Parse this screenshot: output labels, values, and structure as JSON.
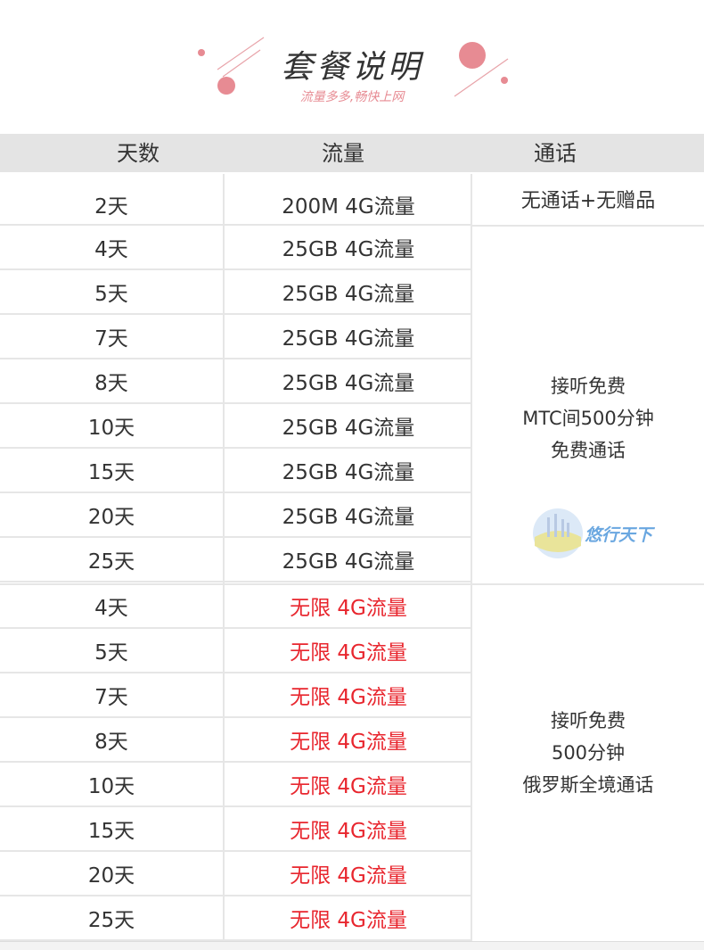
{
  "header": {
    "title": "套餐说明",
    "subtitle": "流量多多,畅快上网"
  },
  "table": {
    "headers": [
      "天数",
      "流量",
      "通话"
    ],
    "rows": [
      {
        "days": "2天",
        "data": "200M 4G流量",
        "red": false
      },
      {
        "days": "4天",
        "data": "25GB 4G流量",
        "red": false
      },
      {
        "days": "5天",
        "data": "25GB 4G流量",
        "red": false
      },
      {
        "days": "7天",
        "data": "25GB 4G流量",
        "red": false
      },
      {
        "days": "8天",
        "data": "25GB 4G流量",
        "red": false
      },
      {
        "days": "10天",
        "data": "25GB 4G流量",
        "red": false
      },
      {
        "days": "15天",
        "data": "25GB 4G流量",
        "red": false
      },
      {
        "days": "20天",
        "data": "25GB 4G流量",
        "red": false
      },
      {
        "days": "25天",
        "data": "25GB 4G流量",
        "red": false
      },
      {
        "days": "4天",
        "data": "无限 4G流量",
        "red": true
      },
      {
        "days": "5天",
        "data": "无限 4G流量",
        "red": true
      },
      {
        "days": "7天",
        "data": "无限 4G流量",
        "red": true
      },
      {
        "days": "8天",
        "data": "无限 4G流量",
        "red": true
      },
      {
        "days": "10天",
        "data": "无限 4G流量",
        "red": true
      },
      {
        "days": "15天",
        "data": "无限 4G流量",
        "red": true
      },
      {
        "days": "20天",
        "data": "无限 4G流量",
        "red": true
      },
      {
        "days": "25天",
        "data": "无限 4G流量",
        "red": true
      }
    ],
    "call_groups": [
      {
        "lines": [
          "无通话+无赠品"
        ]
      },
      {
        "lines": [
          "接听免费",
          "MTC间500分钟",
          "免费通话"
        ]
      },
      {
        "lines": [
          "接听免费",
          "500分钟",
          "俄罗斯全境通话"
        ]
      }
    ]
  },
  "logo": {
    "text": "悠行天下"
  },
  "colors": {
    "accent": "#e78b93",
    "highlight": "#e8262e",
    "header_bg": "#e4e4e4"
  }
}
